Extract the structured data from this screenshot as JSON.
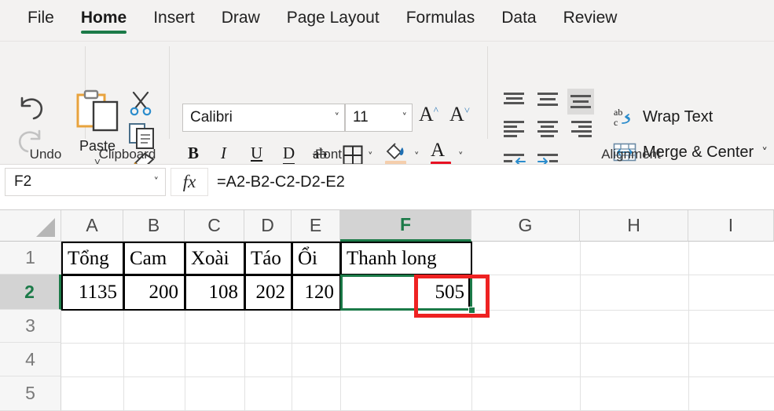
{
  "tabs": [
    {
      "label": "File",
      "active": false
    },
    {
      "label": "Home",
      "active": true
    },
    {
      "label": "Insert",
      "active": false
    },
    {
      "label": "Draw",
      "active": false
    },
    {
      "label": "Page Layout",
      "active": false
    },
    {
      "label": "Formulas",
      "active": false
    },
    {
      "label": "Data",
      "active": false
    },
    {
      "label": "Review",
      "active": false
    }
  ],
  "ribbon": {
    "groups": {
      "undo": "Undo",
      "clipboard": "Clipboard",
      "font": "Font",
      "alignment": "Alignment"
    },
    "undo": {
      "undo_icon": "undo-arrow-icon",
      "redo_icon": "redo-arrow-icon"
    },
    "clipboard": {
      "paste_label": "Paste",
      "paste_icon": "clipboard-icon",
      "cut_icon": "scissors-icon",
      "copy_icon": "copy-icon",
      "format_painter_icon": "paintbrush-icon"
    },
    "font": {
      "font_name": "Calibri",
      "font_size": "11",
      "grow_font_icon": "increase-font-size-icon",
      "shrink_font_icon": "decrease-font-size-icon",
      "bold": "B",
      "italic": "I",
      "underline": "U",
      "double_underline": "D",
      "strikethrough": "ab",
      "borders_icon": "borders-icon",
      "fill_color_icon": "fill-color-icon",
      "fill_color": "#f5ceac",
      "font_color_icon": "font-color-icon",
      "font_color": "#e81123"
    },
    "alignment": {
      "wrap_text_label": "Wrap Text",
      "merge_center_label": "Merge & Center",
      "wrap_icon": "wrap-text-icon",
      "merge_icon": "merge-cells-icon",
      "align_top": "align-top-icon",
      "align_middle": "align-middle-icon",
      "align_bottom": "align-bottom-icon",
      "align_left": "align-left-icon",
      "align_center": "align-center-icon",
      "align_right": "align-right-icon",
      "decrease_indent": "decrease-indent-icon",
      "increase_indent": "increase-indent-icon"
    }
  },
  "formula_bar": {
    "name_box": "F2",
    "fx_label": "fx",
    "formula": "=A2-B2-C2-D2-E2"
  },
  "sheet": {
    "columns": [
      "A",
      "B",
      "C",
      "D",
      "E",
      "F",
      "G",
      "H",
      "I"
    ],
    "rows": [
      "1",
      "2",
      "3",
      "4",
      "5"
    ],
    "selected_column": "F",
    "selected_row": "2",
    "row1": {
      "A": "Tổng",
      "B": "Cam",
      "C": "Xoài",
      "D": "Táo",
      "E": "Ổi",
      "F": "Thanh long"
    },
    "row2": {
      "A": "1135",
      "B": "200",
      "C": "108",
      "D": "202",
      "E": "120",
      "F": "505"
    }
  },
  "annotation": {
    "highlight_color": "#ee2222",
    "selection_color": "#1b7a48"
  }
}
